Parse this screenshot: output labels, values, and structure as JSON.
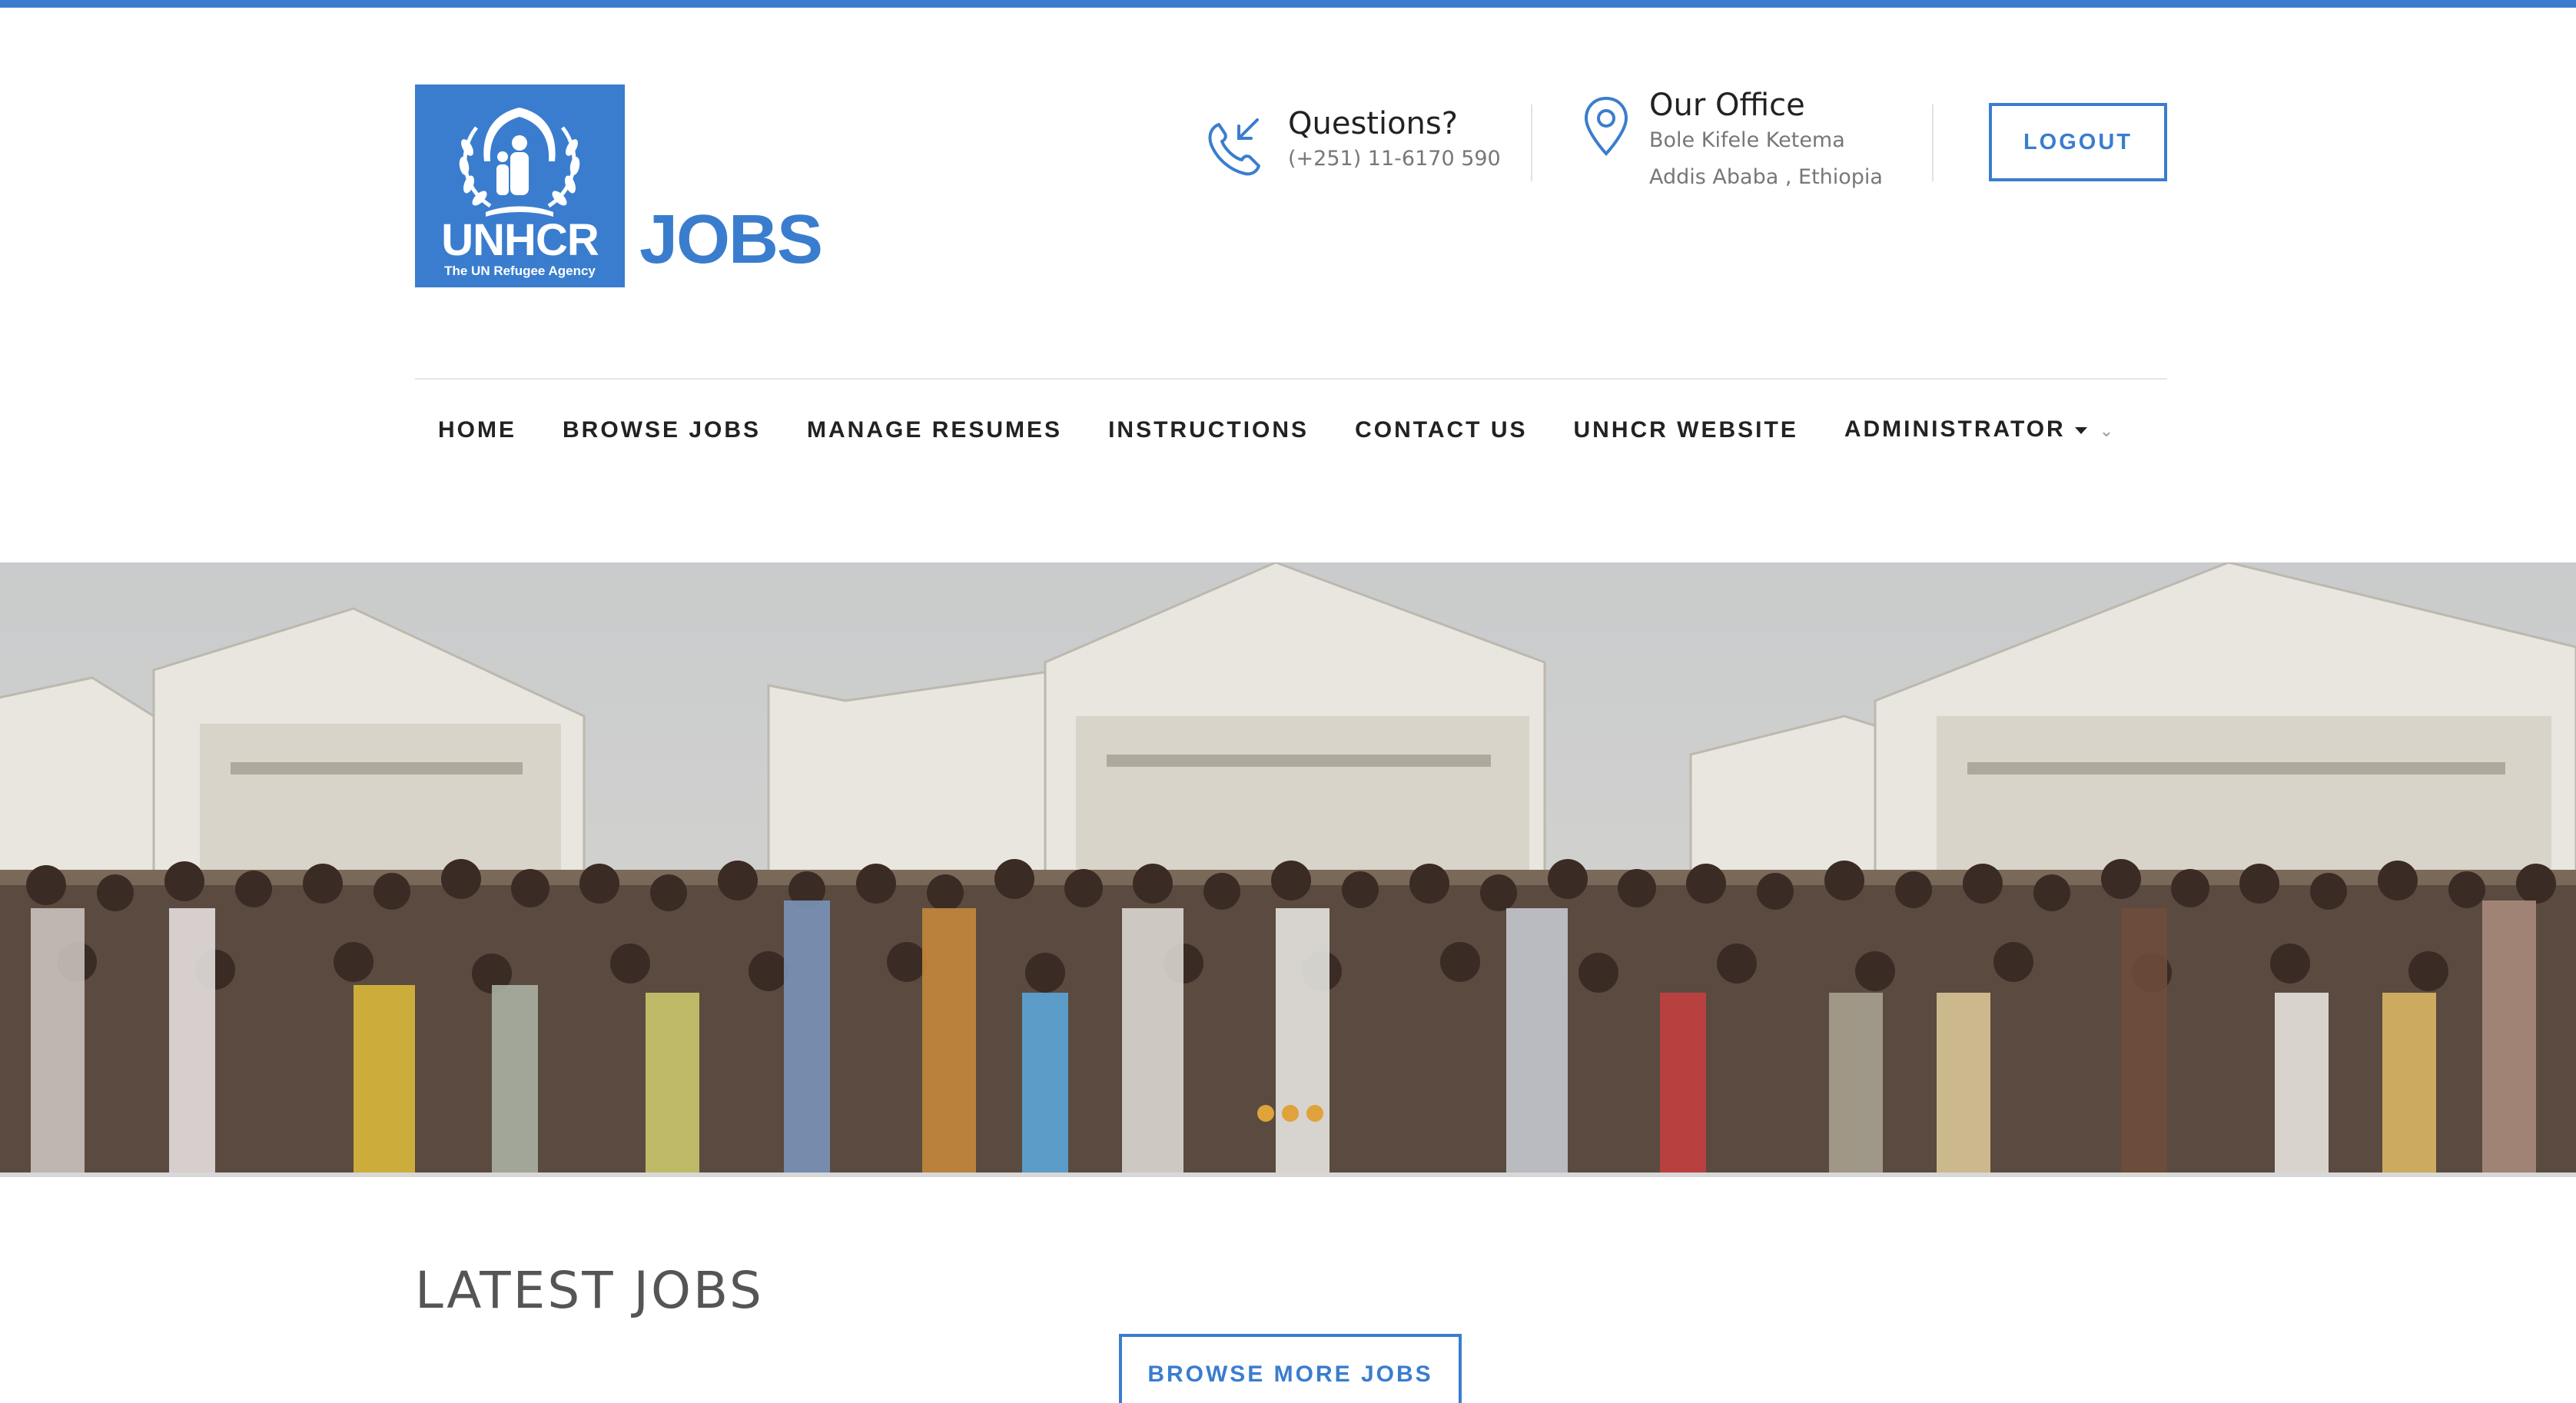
{
  "header": {
    "logo": {
      "org": "UNHCR",
      "tagline": "The UN Refugee Agency",
      "product": "JOBS"
    },
    "questions": {
      "title": "Questions?",
      "phone": "(+251) 11-6170 590"
    },
    "office": {
      "title": "Our Office",
      "line1": "Bole Kifele Ketema",
      "line2": "Addis Ababa , Ethiopia"
    },
    "logout_label": "LOGOUT"
  },
  "nav": {
    "items": [
      {
        "label": "HOME"
      },
      {
        "label": "BROWSE JOBS"
      },
      {
        "label": "MANAGE RESUMES"
      },
      {
        "label": "INSTRUCTIONS"
      },
      {
        "label": "CONTACT US"
      },
      {
        "label": "UNHCR WEBSITE"
      },
      {
        "label": "ADMINISTRATOR"
      }
    ]
  },
  "hero": {
    "slide_count": 3,
    "dot_color": "#e0a23a"
  },
  "latest": {
    "title": "LATEST JOBS",
    "browse_label": "BROWSE MORE JOBS"
  },
  "colors": {
    "accent": "#3a7dce",
    "text": "#222222"
  }
}
